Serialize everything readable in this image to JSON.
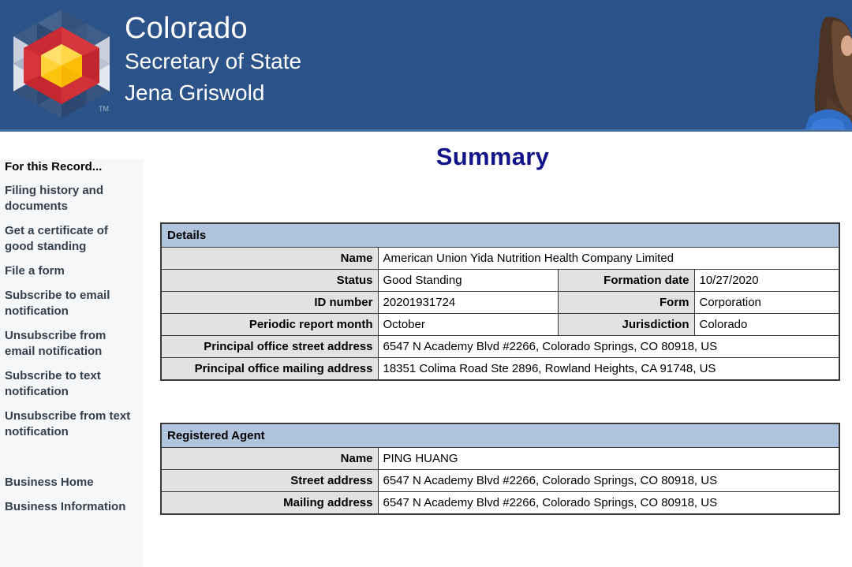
{
  "header": {
    "logo_name": "colorado-hexagon-logo",
    "state": "Colorado",
    "office": "Secretary of State",
    "official": "Jena Griswold",
    "background_color": "#2c5389",
    "portrait_alt": "jena-griswold-portrait"
  },
  "sidebar": {
    "heading": "For this Record...",
    "record_links": [
      "Filing history and documents",
      "Get a certificate of good standing",
      "File a form",
      "Subscribe to email notification",
      "Unsubscribe from email notification",
      "Subscribe to text notification",
      "Unsubscribe from text notification"
    ],
    "nav_links": [
      "Business Home",
      "Business Information"
    ]
  },
  "main": {
    "title": "Summary",
    "title_color": "#11138a",
    "details": {
      "section_label": "Details",
      "rows": [
        {
          "type": "full",
          "label": "Name",
          "value": "American Union Yida Nutrition Health Company Limited"
        },
        {
          "type": "split",
          "label": "Status",
          "value": "Good Standing",
          "label2": "Formation date",
          "value2": "10/27/2020"
        },
        {
          "type": "split",
          "label": "ID number",
          "value": "20201931724",
          "label2": "Form",
          "value2": "Corporation"
        },
        {
          "type": "split",
          "label": "Periodic report month",
          "value": "October",
          "label2": "Jurisdiction",
          "value2": "Colorado"
        },
        {
          "type": "full",
          "label": "Principal office street address",
          "value": "6547 N Academy Blvd #2266, Colorado Springs, CO 80918, US"
        },
        {
          "type": "full",
          "label": "Principal office mailing address",
          "value": "18351 Colima Road Ste 2896, Rowland Heights, CA 91748, US"
        }
      ]
    },
    "registered_agent": {
      "section_label": "Registered Agent",
      "rows": [
        {
          "label": "Name",
          "value": "PING HUANG"
        },
        {
          "label": "Street address",
          "value": "6547 N Academy Blvd #2266, Colorado Springs, CO 80918, US"
        },
        {
          "label": "Mailing address",
          "value": "6547 N Academy Blvd #2266, Colorado Springs, CO 80918, US"
        }
      ]
    }
  }
}
